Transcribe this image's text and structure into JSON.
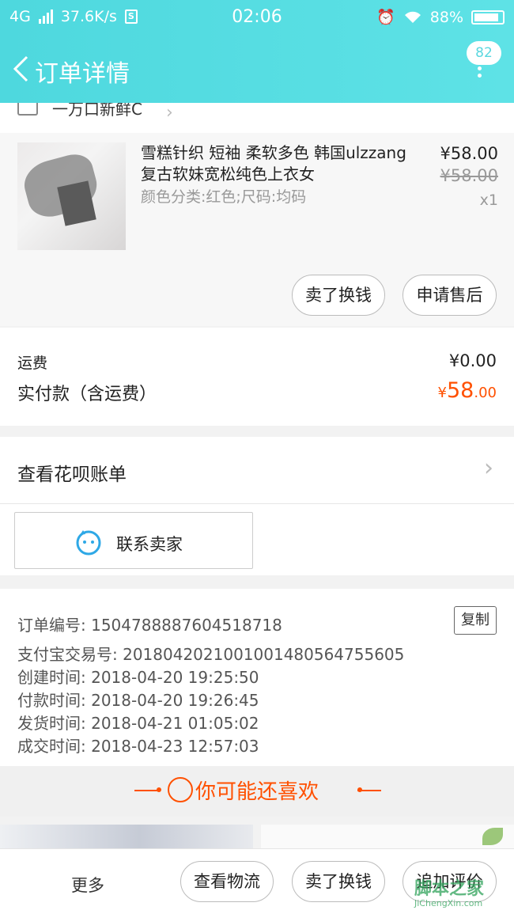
{
  "status_bar": {
    "network": "4G",
    "speed": "37.6K/s",
    "speed_icon": "S",
    "time": "02:06",
    "battery": "88%"
  },
  "header": {
    "title": "订单详情",
    "badge_count": "82"
  },
  "shop": {
    "name": "一万口新鲜C"
  },
  "product": {
    "title": "雪糕针织 短袖 柔软多色 韩国ulzzang复古软妹宽松纯色上衣女",
    "sku": "颜色分类:红色;尺码:均码",
    "price": "¥58.00",
    "original_price": "¥58.00",
    "quantity": "x1",
    "sell_button": "卖了换钱",
    "aftersale_button": "申请售后"
  },
  "fees": {
    "shipping_label": "运费",
    "shipping_value": "¥0.00",
    "paid_label": "实付款（含运费）",
    "paid_currency": "¥",
    "paid_int": "58",
    "paid_dec": ".00"
  },
  "huabei": {
    "label": "查看花呗账单"
  },
  "contact": {
    "label": "联系卖家"
  },
  "order_info": {
    "copy_button": "复制",
    "rows": [
      "订单编号: 1504788887604518718",
      "支付宝交易号: 2018042021001001480564755605",
      "创建时间: 2018-04-20 19:25:50",
      "付款时间: 2018-04-20 19:26:45",
      "发货时间: 2018-04-21 01:05:02",
      "成交时间: 2018-04-23 12:57:03"
    ]
  },
  "recommend": {
    "title": "你可能还喜欢"
  },
  "bottom_bar": {
    "more": "更多",
    "logistics": "查看物流",
    "sell": "卖了换钱",
    "review": "追加评价"
  },
  "watermark": {
    "text": "脚本之家",
    "sub": "JiChengXin.com"
  },
  "colors": {
    "accent": "#ff5000",
    "header": "#55dde2"
  }
}
